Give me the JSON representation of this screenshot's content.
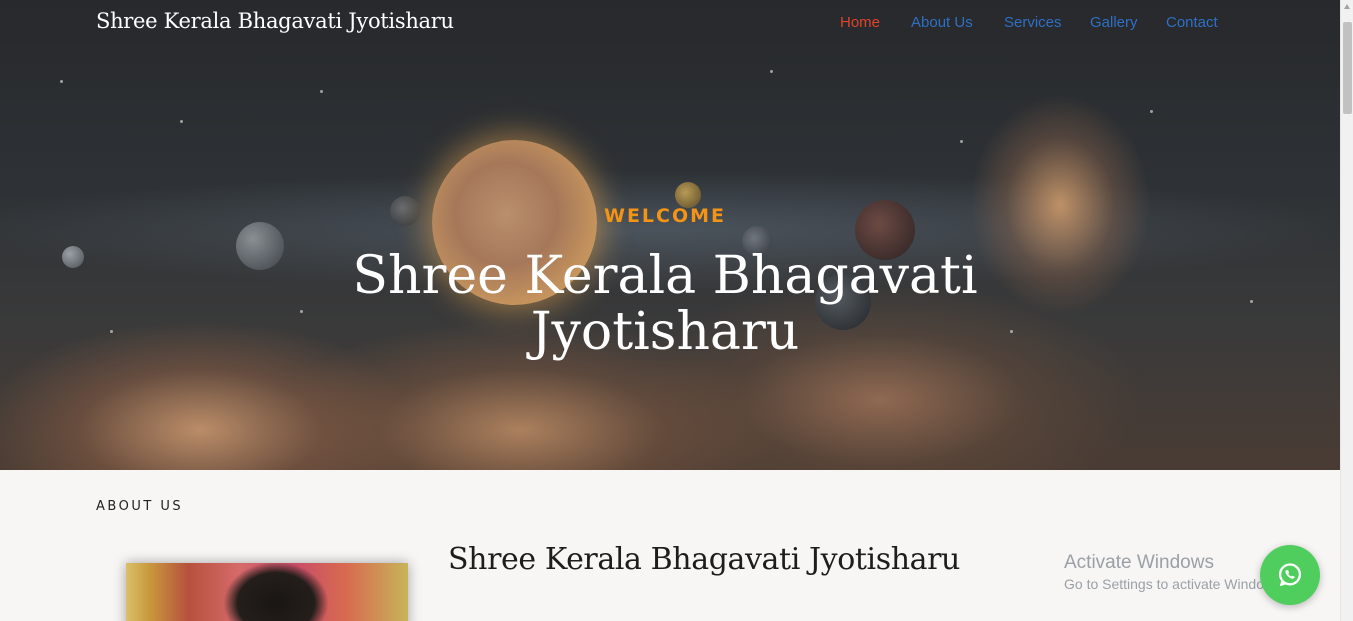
{
  "header": {
    "brand": "Shree Kerala Bhagavati Jyotisharu",
    "nav": [
      {
        "label": "Home",
        "active": true
      },
      {
        "label": "About Us",
        "active": false
      },
      {
        "label": "Services",
        "active": false
      },
      {
        "label": "Gallery",
        "active": false
      },
      {
        "label": "Contact",
        "active": false
      }
    ]
  },
  "hero": {
    "kicker": "WELCOME",
    "title_line1": "Shree Kerala Bhagavati",
    "title_line2": "Jyotisharu"
  },
  "about": {
    "kicker": "ABOUT US",
    "title": "Shree Kerala Bhagavati Jyotisharu"
  },
  "overlay": {
    "activate_title": "Activate Windows",
    "activate_subtitle": "Go to Settings to activate Windows."
  },
  "widgets": {
    "whatsapp_icon": "whatsapp-icon"
  },
  "colors": {
    "nav_link": "#2f6fc4",
    "nav_active": "#e0442a",
    "welcome": "#f39417",
    "whatsapp": "#4fce5d"
  }
}
